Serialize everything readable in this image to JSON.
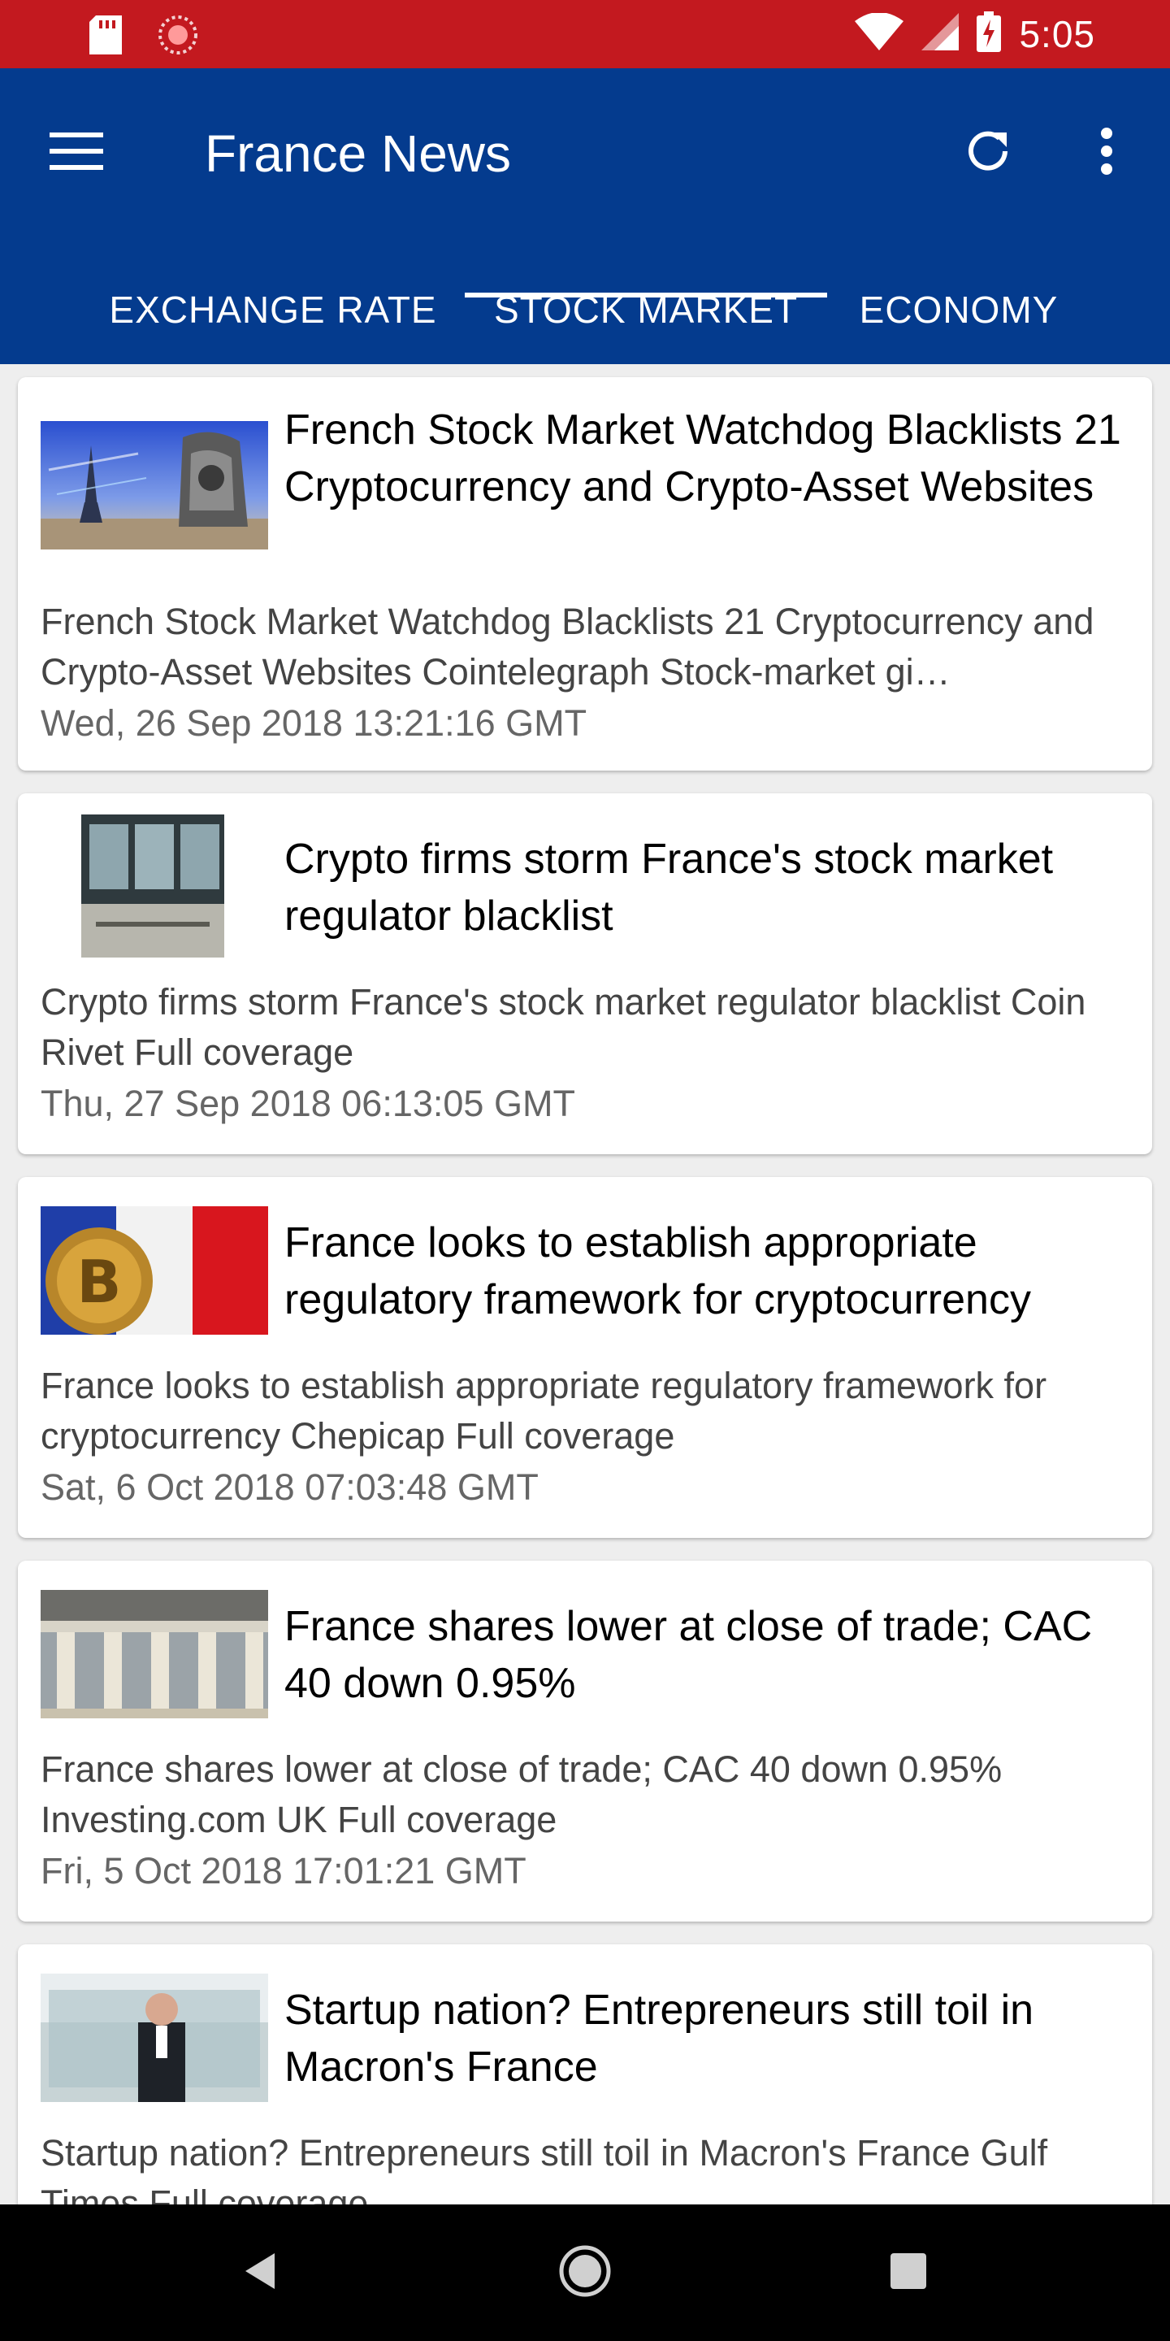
{
  "status_bar": {
    "time": "5:05",
    "color": "#c3191f",
    "left_icons": [
      "sd-card-icon",
      "sync-icon"
    ],
    "right_icons": [
      "wifi-icon",
      "signal-icon",
      "battery-charging-icon"
    ]
  },
  "app_bar": {
    "title": "France News",
    "color": "#043b8e",
    "icons": [
      "menu-icon",
      "refresh-icon",
      "more-vert-icon"
    ]
  },
  "tabs": [
    {
      "label": "EXCHANGE RATE",
      "selected": false
    },
    {
      "label": "STOCK MARKET",
      "selected": true
    },
    {
      "label": "ECONOMY",
      "selected": false
    }
  ],
  "articles": [
    {
      "title": "French Stock Market Watchdog Blacklists 21 Cryptocurrency and Crypto-Asset Websites",
      "summary": "French Stock Market Watchdog Blacklists 21 Cryptocurrency and Crypto-Asset Websites  Cointelegraph  Stock-market gi…",
      "date": "Wed, 26 Sep 2018 13:21:16 GMT"
    },
    {
      "title": "Crypto firms storm France's stock market regulator blacklist",
      "summary": "Crypto firms storm France's stock market regulator blacklist  Coin Rivet  Full coverage",
      "date": "Thu, 27 Sep 2018 06:13:05 GMT"
    },
    {
      "title": "France looks to establish appropriate regulatory framework for cryptocurrency",
      "summary": "France looks to establish appropriate regulatory framework for cryptocurrency  Chepicap  Full coverage",
      "date": "Sat, 6 Oct 2018 07:03:48 GMT"
    },
    {
      "title": "France shares lower at close of trade; CAC 40 down 0.95%",
      "summary": "France shares lower at close of trade; CAC 40 down 0.95%  Investing.com UK  Full coverage",
      "date": "Fri, 5 Oct 2018 17:01:21 GMT"
    },
    {
      "title": "Startup nation? Entrepreneurs still toil in Macron's France",
      "summary": "Startup nation? Entrepreneurs still toil in Macron's France  Gulf Times  Full coverage",
      "date": ""
    }
  ],
  "nav_bar": {
    "icons": [
      "back-icon",
      "home-icon",
      "recents-icon"
    ]
  }
}
